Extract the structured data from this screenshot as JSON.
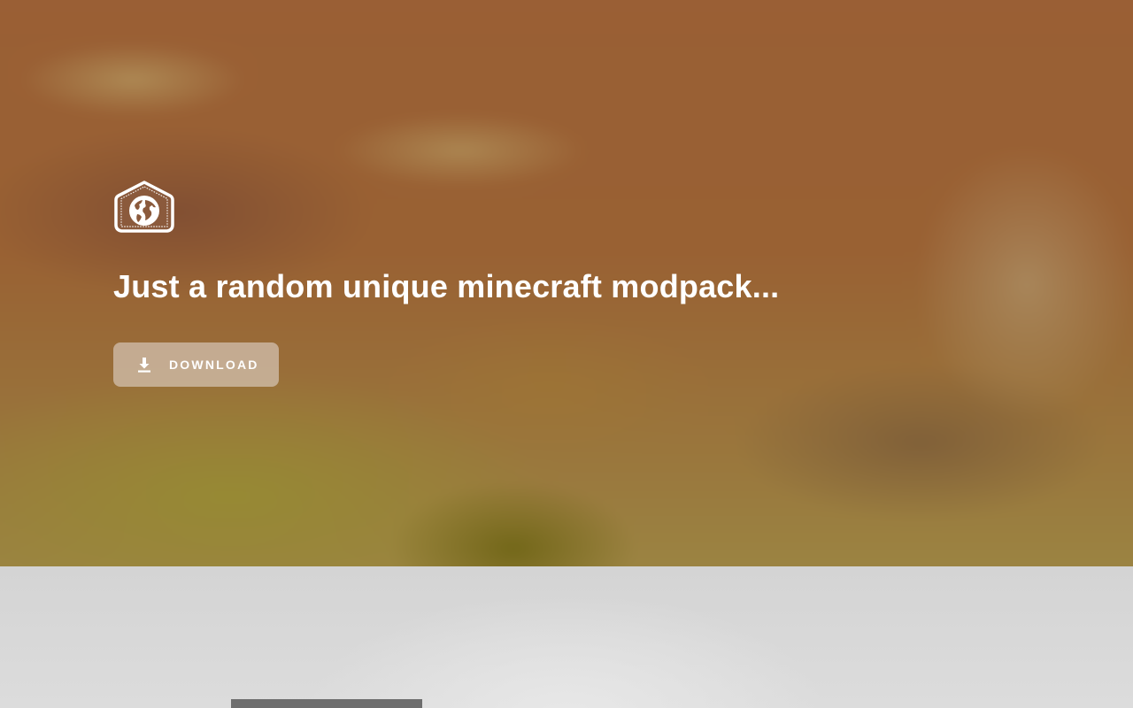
{
  "hero": {
    "logo_icon": "globe-house-logo-icon",
    "tagline": "Just a random unique minecraft modpack...",
    "download_button": {
      "label": "DOWNLOAD",
      "icon": "download-icon"
    }
  },
  "colors": {
    "hero_base": "#9a6236",
    "button_bg": "#d6c7ba",
    "text": "#ffffff",
    "section_bg": "#d8d8d8",
    "card": "#6e6e6e"
  }
}
